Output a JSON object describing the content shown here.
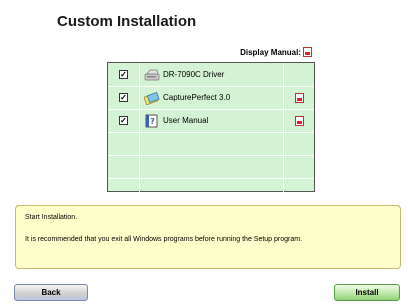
{
  "title": "Custom Installation",
  "display_manual_label": "Display Manual:",
  "components": [
    {
      "name": "DR-7090C Driver",
      "checked": true,
      "icon": "scanner-icon",
      "has_manual": false
    },
    {
      "name": "CapturePerfect 3.0",
      "checked": true,
      "icon": "captureperfect-icon",
      "has_manual": true
    },
    {
      "name": "User Manual",
      "checked": true,
      "icon": "manual-book-icon",
      "has_manual": true
    }
  ],
  "info": {
    "line1": "Start Installation.",
    "line2": "It is recommended that you exit all Windows programs before running the Setup program."
  },
  "buttons": {
    "back": "Back",
    "install": "Install"
  },
  "colors": {
    "table_bg": "#d4f2d4",
    "info_bg": "#ffffcc",
    "install_green": "#8fd17a"
  }
}
